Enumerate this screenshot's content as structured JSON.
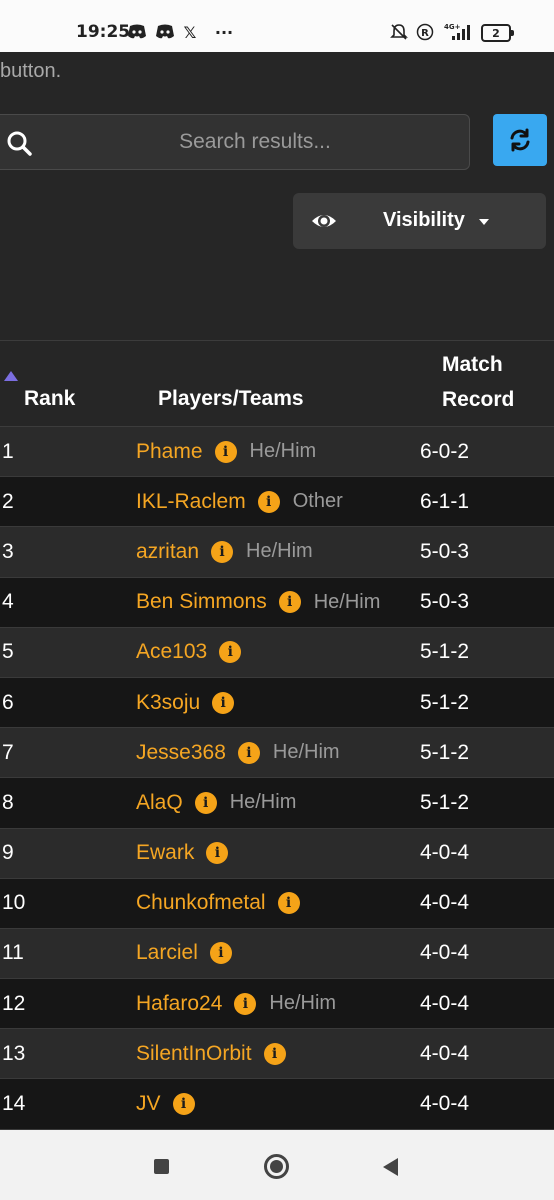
{
  "status_bar": {
    "time": "19:25",
    "left_icons": [
      "discord-icon",
      "discord-icon",
      "x-icon",
      "more-dots-icon"
    ],
    "right_icons": [
      "bell-off-icon",
      "registered-icon",
      "signal-4g-icon"
    ],
    "network": "4G+",
    "battery": "2"
  },
  "intro_text": "button.",
  "search": {
    "placeholder": "Search results..."
  },
  "visibility": {
    "label": "Visibility"
  },
  "table": {
    "headers": {
      "rank": "Rank",
      "players": "Players/Teams",
      "record_line1": "Match",
      "record_line2": "Record"
    },
    "rows": [
      {
        "rank": "1",
        "name": "Phame",
        "pronoun": "He/Him",
        "record": "6-0-2"
      },
      {
        "rank": "2",
        "name": "IKL-Raclem",
        "pronoun": "Other",
        "record": "6-1-1"
      },
      {
        "rank": "3",
        "name": "azritan",
        "pronoun": "He/Him",
        "record": "5-0-3"
      },
      {
        "rank": "4",
        "name": "Ben Simmons",
        "pronoun": "He/Him",
        "record": "5-0-3"
      },
      {
        "rank": "5",
        "name": "Ace103",
        "pronoun": "",
        "record": "5-1-2"
      },
      {
        "rank": "6",
        "name": "K3soju",
        "pronoun": "",
        "record": "5-1-2"
      },
      {
        "rank": "7",
        "name": "Jesse368",
        "pronoun": "He/Him",
        "record": "5-1-2"
      },
      {
        "rank": "8",
        "name": "AlaQ",
        "pronoun": "He/Him",
        "record": "5-1-2"
      },
      {
        "rank": "9",
        "name": "Ewark",
        "pronoun": "",
        "record": "4-0-4"
      },
      {
        "rank": "10",
        "name": "Chunkofmetal",
        "pronoun": "",
        "record": "4-0-4"
      },
      {
        "rank": "11",
        "name": "Larciel",
        "pronoun": "",
        "record": "4-0-4"
      },
      {
        "rank": "12",
        "name": "Hafaro24",
        "pronoun": "He/Him",
        "record": "4-0-4"
      },
      {
        "rank": "13",
        "name": "SilentInOrbit",
        "pronoun": "",
        "record": "4-0-4"
      },
      {
        "rank": "14",
        "name": "JV",
        "pronoun": "",
        "record": "4-0-4"
      }
    ]
  },
  "colors": {
    "accent_name": "#f5a623",
    "refresh_button": "#39a8f0",
    "sort_indicator": "#7b6ee0"
  },
  "nav_icons": [
    "recents-square-icon",
    "home-circle-icon",
    "back-triangle-icon"
  ]
}
